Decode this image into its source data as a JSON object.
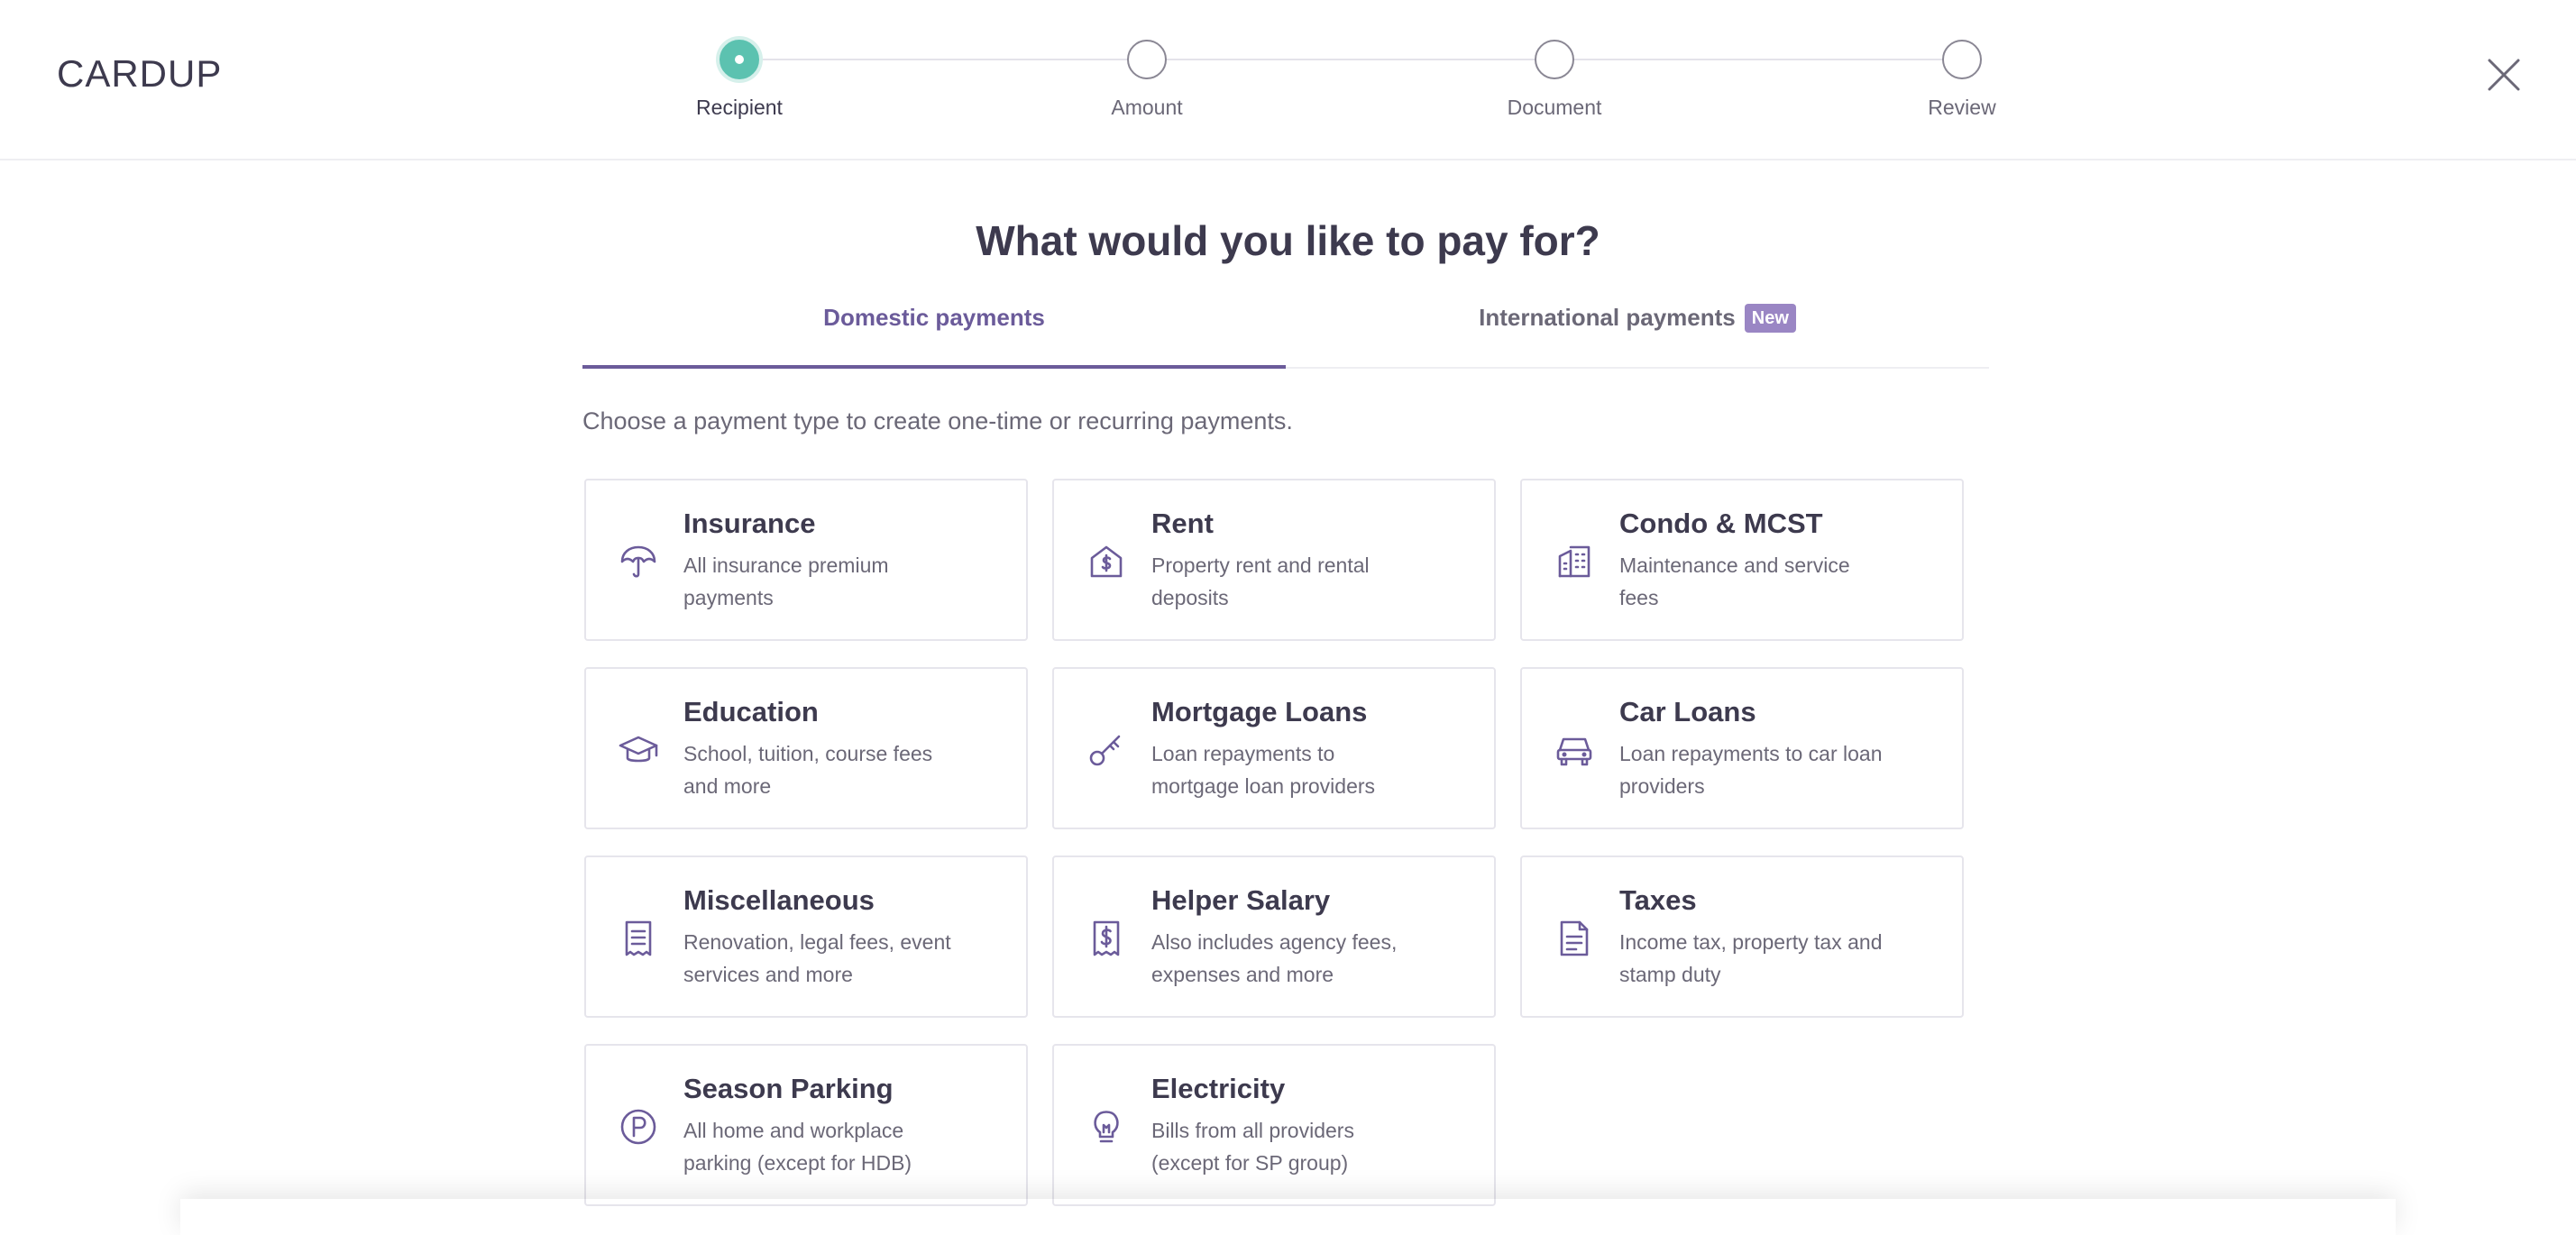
{
  "logo": {
    "text": "CARDUP"
  },
  "stepper": {
    "steps": [
      {
        "label": "Recipient",
        "active": true
      },
      {
        "label": "Amount",
        "active": false
      },
      {
        "label": "Document",
        "active": false
      },
      {
        "label": "Review",
        "active": false
      }
    ]
  },
  "page": {
    "title": "What would you like to pay for?",
    "subtitle": "Choose a payment type to create one-time or recurring payments."
  },
  "tabs": {
    "domestic": "Domestic payments",
    "international": "International payments",
    "international_badge": "New"
  },
  "colors": {
    "accent": "#6b5b9a",
    "step_active": "#5cc2b0",
    "badge": "#9a86c4",
    "icon": "#6b5b9a"
  },
  "cards": [
    {
      "title": "Insurance",
      "desc": "All insurance premium payments",
      "icon": "umbrella-icon"
    },
    {
      "title": "Rent",
      "desc": "Property rent and rental deposits",
      "icon": "house-dollar-icon"
    },
    {
      "title": "Condo & MCST",
      "desc": "Maintenance and service fees",
      "icon": "building-icon"
    },
    {
      "title": "Education",
      "desc": "School, tuition, course fees and more",
      "icon": "graduation-cap-icon"
    },
    {
      "title": "Mortgage Loans",
      "desc": "Loan repayments to mortgage loan providers",
      "icon": "key-icon"
    },
    {
      "title": "Car Loans",
      "desc": "Loan repayments to car loan providers",
      "icon": "car-icon"
    },
    {
      "title": "Miscellaneous",
      "desc": "Renovation, legal fees, event services and more",
      "icon": "receipt-icon"
    },
    {
      "title": "Helper Salary",
      "desc": "Also includes agency fees, expenses and more",
      "icon": "dollar-receipt-icon"
    },
    {
      "title": "Taxes",
      "desc": "Income tax, property tax and stamp duty",
      "icon": "document-icon"
    },
    {
      "title": "Season Parking",
      "desc": "All home and workplace parking (except for HDB)",
      "icon": "parking-icon"
    },
    {
      "title": "Electricity",
      "desc": "Bills from all providers (except for SP group)",
      "icon": "lightbulb-icon"
    }
  ]
}
